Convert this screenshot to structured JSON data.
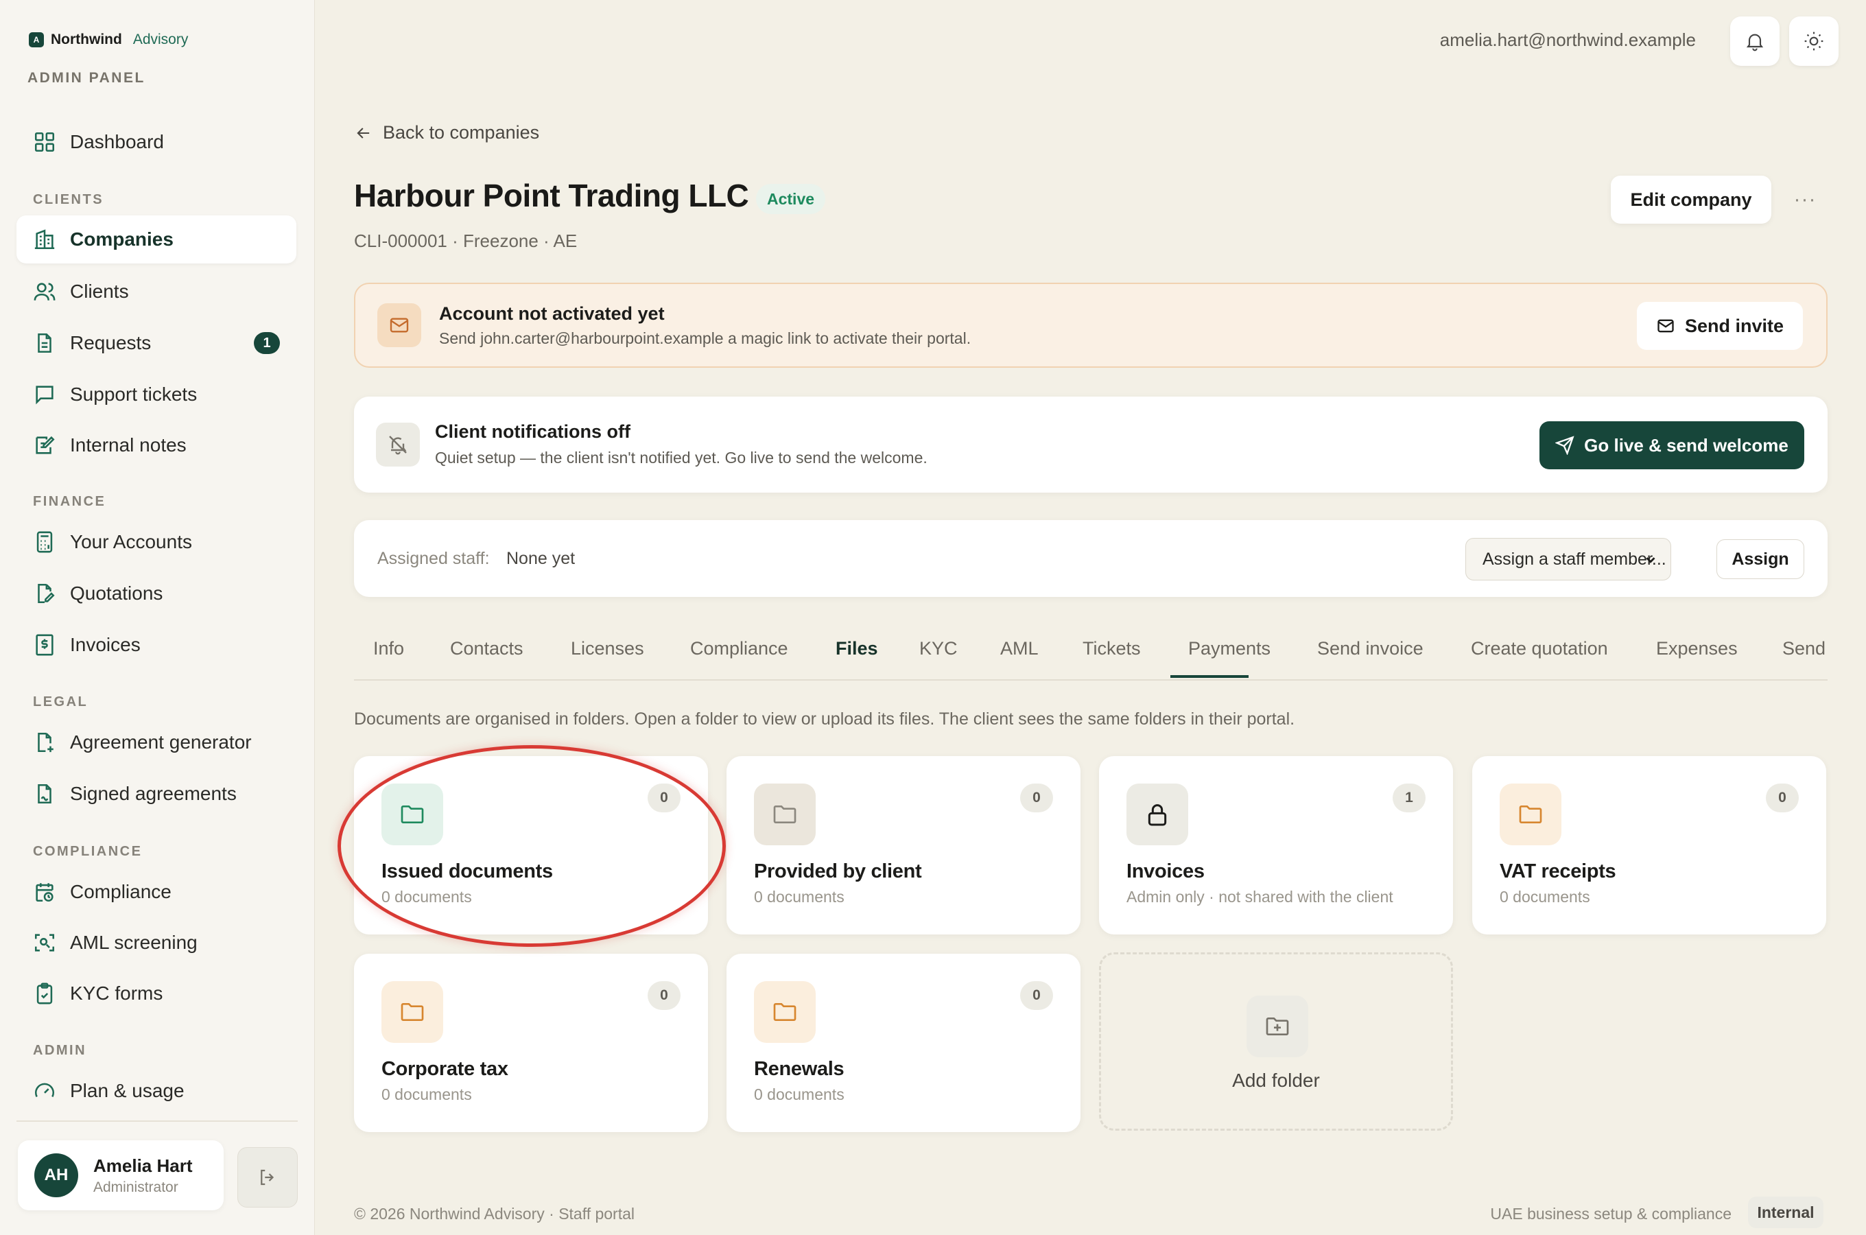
{
  "brand": {
    "name": "Northwind",
    "sub": "Advisory",
    "mark": "A",
    "panel_label": "ADMIN PANEL"
  },
  "nav": {
    "dashboard": "Dashboard",
    "sections": {
      "clients": "CLIENTS",
      "finance": "FINANCE",
      "legal": "LEGAL",
      "compliance": "COMPLIANCE",
      "admin": "ADMIN"
    },
    "companies": "Companies",
    "clients": "Clients",
    "requests": "Requests",
    "requests_badge": "1",
    "support_tickets": "Support tickets",
    "internal_notes": "Internal notes",
    "your_accounts": "Your Accounts",
    "quotations": "Quotations",
    "invoices": "Invoices",
    "agreement_generator": "Agreement generator",
    "signed_agreements": "Signed agreements",
    "compliance": "Compliance",
    "aml_screening": "AML screening",
    "kyc_forms": "KYC forms",
    "plan_usage": "Plan & usage"
  },
  "user": {
    "initials": "AH",
    "name": "Amelia Hart",
    "role": "Administrator",
    "email": "amelia.hart@northwind.example"
  },
  "header": {
    "back": "Back to companies",
    "title": "Harbour Point Trading LLC",
    "status": "Active",
    "meta": "CLI-000001 · Freezone · AE",
    "edit": "Edit company",
    "more": "···"
  },
  "warn_banner": {
    "title": "Account not activated yet",
    "text": "Send john.carter@harbourpoint.example a magic link to activate their portal.",
    "button": "Send invite"
  },
  "notif_banner": {
    "title": "Client notifications off",
    "text": "Quiet setup — the client isn't notified yet. Go live to send the welcome.",
    "button": "Go live & send welcome"
  },
  "assign": {
    "label": "Assigned staff:",
    "value": "None yet",
    "select": "Assign a staff member...",
    "button": "Assign"
  },
  "tabs": [
    "Info",
    "Contacts",
    "Licenses",
    "Compliance",
    "Files",
    "KYC",
    "AML",
    "Tickets",
    "Payments",
    "Send invoice",
    "Create quotation",
    "Expenses",
    "Send"
  ],
  "active_tab": "Files",
  "files": {
    "description": "Documents are organised in folders. Open a folder to view or upload its files. The client sees the same folders in their portal.",
    "folders": [
      {
        "name": "Issued documents",
        "sub": "0 documents",
        "count": "0"
      },
      {
        "name": "Provided by client",
        "sub": "0 documents",
        "count": "0"
      },
      {
        "name": "Invoices",
        "sub": "Admin only · not shared with the client",
        "count": "1"
      },
      {
        "name": "VAT receipts",
        "sub": "0 documents",
        "count": "0"
      },
      {
        "name": "Corporate tax",
        "sub": "0 documents",
        "count": "0"
      },
      {
        "name": "Renewals",
        "sub": "0 documents",
        "count": "0"
      }
    ],
    "add_folder": "Add folder"
  },
  "colors": {
    "accent": "#17463a",
    "accent_green": "#1e8a5e",
    "warn_bg": "#faf0e4",
    "highlight": "#d83a34"
  },
  "footer": {
    "left": "© 2026 Northwind Advisory · Staff portal",
    "right": "UAE business setup & compliance",
    "badge": "Internal"
  }
}
